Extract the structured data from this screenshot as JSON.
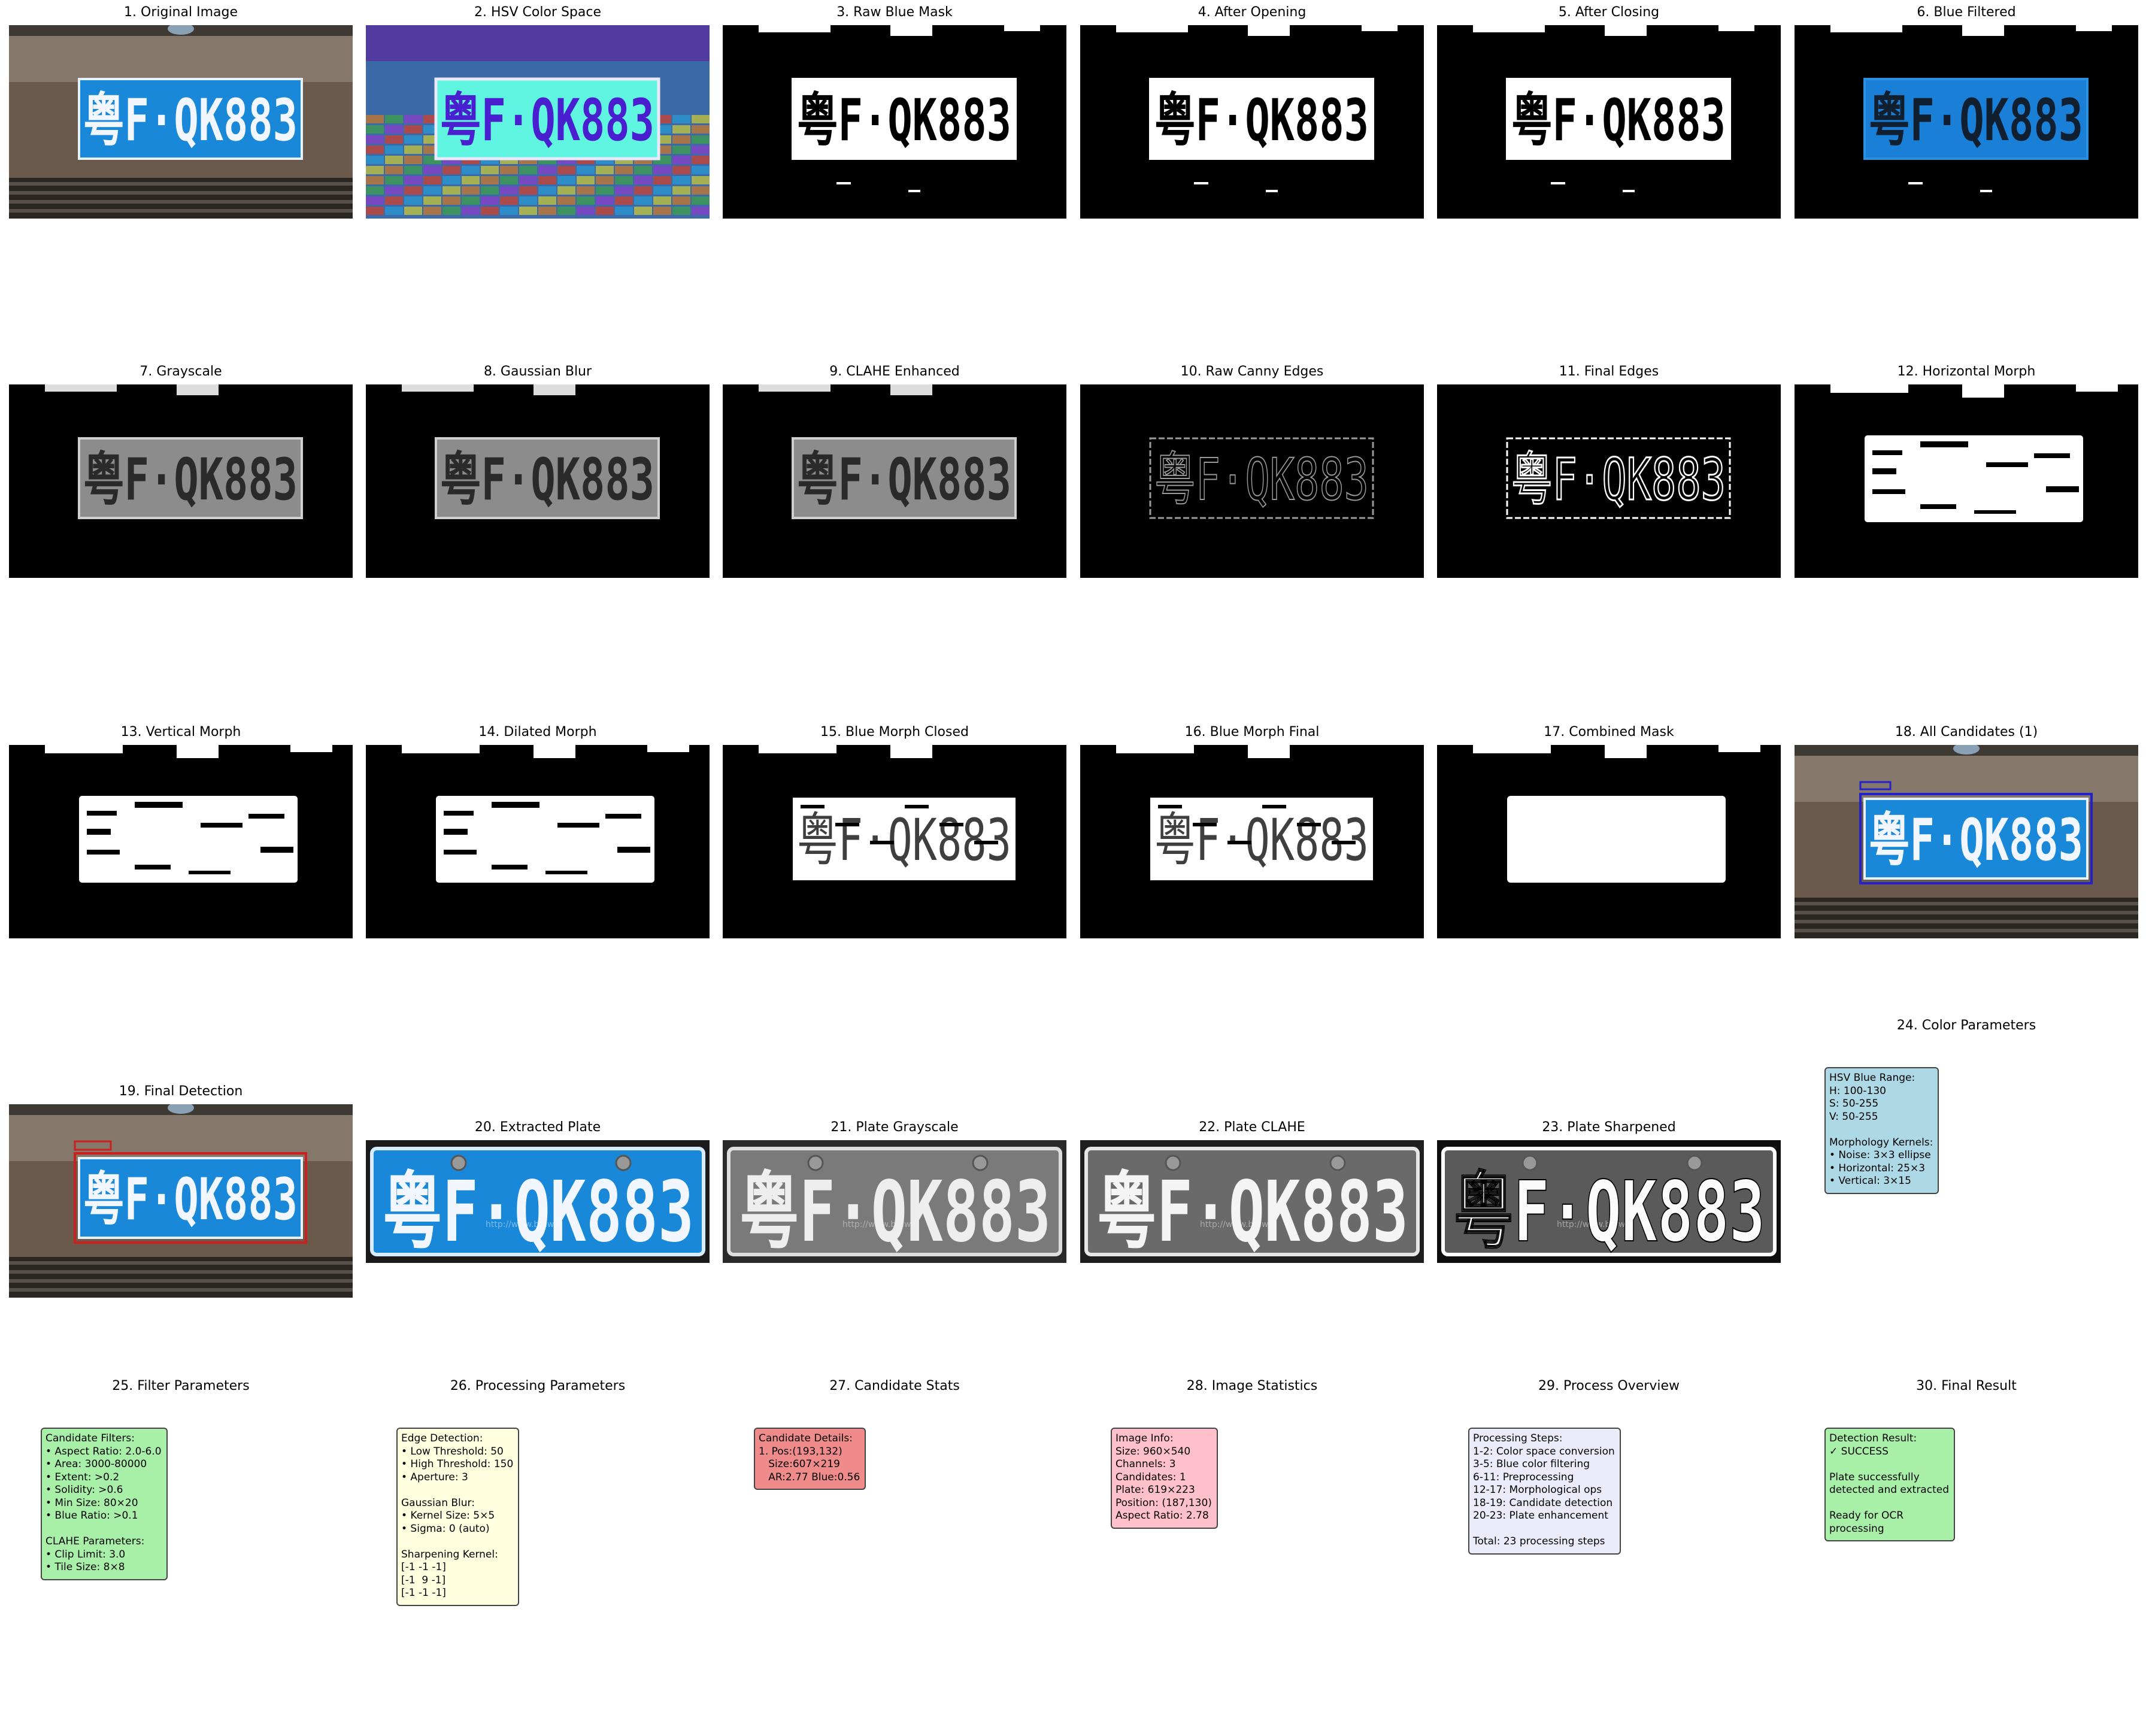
{
  "panels": [
    {
      "title": "1. Original Image"
    },
    {
      "title": "2. HSV Color Space"
    },
    {
      "title": "3. Raw Blue Mask"
    },
    {
      "title": "4. After Opening"
    },
    {
      "title": "5. After Closing"
    },
    {
      "title": "6. Blue Filtered"
    },
    {
      "title": "7. Grayscale"
    },
    {
      "title": "8. Gaussian Blur"
    },
    {
      "title": "9. CLAHE Enhanced"
    },
    {
      "title": "10. Raw Canny Edges"
    },
    {
      "title": "11. Final Edges"
    },
    {
      "title": "12. Horizontal Morph"
    },
    {
      "title": "13. Vertical Morph"
    },
    {
      "title": "14. Dilated Morph"
    },
    {
      "title": "15. Blue Morph Closed"
    },
    {
      "title": "16. Blue Morph Final"
    },
    {
      "title": "17. Combined Mask"
    },
    {
      "title": "18. All Candidates (1)"
    },
    {
      "title": "19. Final Detection"
    },
    {
      "title": "20. Extracted Plate"
    },
    {
      "title": "21. Plate Grayscale"
    },
    {
      "title": "22. Plate CLAHE"
    },
    {
      "title": "23. Plate Sharpened"
    },
    {
      "title": "24. Color Parameters"
    },
    {
      "title": "25. Filter Parameters"
    },
    {
      "title": "26. Processing Parameters"
    },
    {
      "title": "27. Candidate Stats"
    },
    {
      "title": "28. Image Statistics"
    },
    {
      "title": "29. Process Overview"
    },
    {
      "title": "30. Final Result"
    }
  ],
  "plate_text": "粤F·QK883",
  "watermark_text": "http://www.bmw...",
  "info_boxes": {
    "color_params": "HSV Blue Range:\nH: 100-130\nS: 50-255\nV: 50-255\n\nMorphology Kernels:\n• Noise: 3×3 ellipse\n• Horizontal: 25×3\n• Vertical: 3×15",
    "filter_params": "Candidate Filters:\n• Aspect Ratio: 2.0-6.0\n• Area: 3000-80000\n• Extent: >0.2\n• Solidity: >0.6\n• Min Size: 80×20\n• Blue Ratio: >0.1\n\nCLAHE Parameters:\n• Clip Limit: 3.0\n• Tile Size: 8×8",
    "processing_params": "Edge Detection:\n• Low Threshold: 50\n• High Threshold: 150\n• Aperture: 3\n\nGaussian Blur:\n• Kernel Size: 5×5\n• Sigma: 0 (auto)\n\nSharpening Kernel:\n[-1 -1 -1]\n[-1  9 -1]\n[-1 -1 -1]",
    "candidate_stats": "Candidate Details:\n1. Pos:(193,132)\n   Size:607×219\n   AR:2.77 Blue:0.56",
    "image_stats": "Image Info:\nSize: 960×540\nChannels: 3\nCandidates: 1\nPlate: 619×223\nPosition: (187,130)\nAspect Ratio: 2.78",
    "process_overview": "Processing Steps:\n1-2: Color space conversion\n3-5: Blue color filtering\n6-11: Preprocessing\n12-17: Morphological ops\n18-19: Candidate detection\n20-23: Plate enhancement\n\nTotal: 23 processing steps",
    "final_result": "Detection Result:\n✓ SUCCESS\n\nPlate successfully\ndetected and extracted\n\nReady for OCR\nprocessing"
  },
  "colors": {
    "plate_blue": "#1a88d8",
    "car_brown": "#6b5a4c",
    "hsv_cyan": "#5ff5e0",
    "hsv_purple": "#4a1fd0",
    "detect_red": "#cc1f1f",
    "cand_blue": "#2222cc"
  }
}
